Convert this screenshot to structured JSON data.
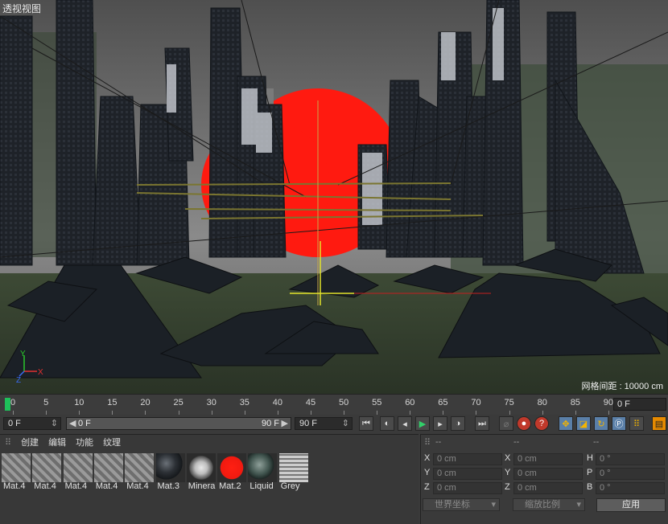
{
  "viewport": {
    "title": "透视视图",
    "grid_spacing": "网格间距 : 10000 cm"
  },
  "timeline": {
    "ticks": [
      "0",
      "5",
      "10",
      "15",
      "20",
      "25",
      "30",
      "35",
      "40",
      "45",
      "50",
      "55",
      "60",
      "65",
      "70",
      "75",
      "80",
      "85",
      "90"
    ],
    "end_frame": "0 F"
  },
  "transport": {
    "current_frame": "0 F",
    "range_start": "0 F",
    "range_end": "90 F",
    "max_frame": "90 F"
  },
  "materials": {
    "menu": [
      "创建",
      "编辑",
      "功能",
      "纹理"
    ],
    "items": [
      {
        "label": "Mat.4",
        "kind": "striped"
      },
      {
        "label": "Mat.4",
        "kind": "striped"
      },
      {
        "label": "Mat.4",
        "kind": "striped"
      },
      {
        "label": "Mat.4",
        "kind": "striped"
      },
      {
        "label": "Mat.4",
        "kind": "striped"
      },
      {
        "label": "Mat.3",
        "kind": "dark-sphere"
      },
      {
        "label": "Minera",
        "kind": "mineral"
      },
      {
        "label": "Mat.2",
        "kind": "red-sphere"
      },
      {
        "label": "Liquid",
        "kind": "liquid"
      },
      {
        "label": "Grey",
        "kind": "grey-grid"
      }
    ]
  },
  "attributes": {
    "header": [
      "--",
      "--",
      "--"
    ],
    "rows": [
      {
        "a": "X",
        "av": "0 cm",
        "b": "X",
        "bv": "0 cm",
        "c": "H",
        "cv": "0 °"
      },
      {
        "a": "Y",
        "av": "0 cm",
        "b": "Y",
        "bv": "0 cm",
        "c": "P",
        "cv": "0 °"
      },
      {
        "a": "Z",
        "av": "0 cm",
        "b": "Z",
        "bv": "0 cm",
        "c": "B",
        "cv": "0 °"
      }
    ],
    "coord_mode": "世界坐标",
    "scale_mode": "缩放比例",
    "apply": "应用"
  }
}
